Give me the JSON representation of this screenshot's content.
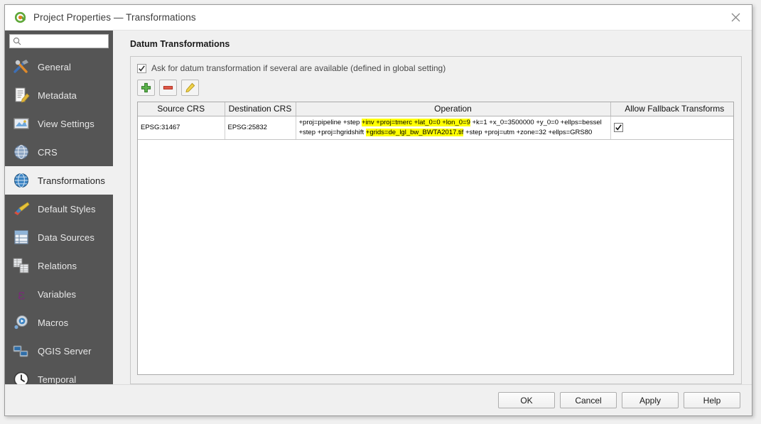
{
  "window": {
    "title": "Project Properties — Transformations",
    "app_icon": "qgis-logo-icon",
    "close_label": "×"
  },
  "sidebar": {
    "search": {
      "value": "",
      "placeholder": ""
    },
    "items": [
      {
        "label": "General",
        "icon": "hammer-wrench-icon"
      },
      {
        "label": "Metadata",
        "icon": "document-pencil-icon"
      },
      {
        "label": "View Settings",
        "icon": "map-view-icon"
      },
      {
        "label": "CRS",
        "icon": "globe-grid-icon"
      },
      {
        "label": "Transformations",
        "icon": "globe-blue-icon"
      },
      {
        "label": "Default Styles",
        "icon": "paintbrush-icon"
      },
      {
        "label": "Data Sources",
        "icon": "table-grid-icon"
      },
      {
        "label": "Relations",
        "icon": "two-tables-icon"
      },
      {
        "label": "Variables",
        "icon": "epsilon-icon"
      },
      {
        "label": "Macros",
        "icon": "gear-play-icon"
      },
      {
        "label": "QGIS Server",
        "icon": "servers-icon"
      },
      {
        "label": "Temporal",
        "icon": "clock-icon"
      }
    ],
    "selected_index": 4
  },
  "main": {
    "group_title": "Datum Transformations",
    "ask_checkbox": {
      "label": "Ask for datum transformation if several are available (defined in global setting)",
      "checked": true
    },
    "toolbar": [
      {
        "name": "add-transformation-button",
        "icon": "green-plus-icon",
        "tooltip": "Add"
      },
      {
        "name": "remove-transformation-button",
        "icon": "red-minus-icon",
        "tooltip": "Remove"
      },
      {
        "name": "edit-transformation-button",
        "icon": "yellow-pencil-icon",
        "tooltip": "Edit"
      }
    ],
    "table": {
      "columns": [
        "Source CRS",
        "Destination CRS",
        "Operation",
        "Allow Fallback Transforms"
      ],
      "rows": [
        {
          "source_crs": "EPSG:31467",
          "destination_crs": "EPSG:25832",
          "operation_line1_pre": "+proj=pipeline +step ",
          "operation_line1_hl": "+inv +proj=tmerc +lat_0=0 +lon_0=9",
          "operation_line1_post": " +k=1 +x_0=3500000 +y_0=0 +ellps=bessel",
          "operation_line2_pre": "+step +proj=hgridshift ",
          "operation_line2_hl": "+grids=de_lgl_bw_BWTA2017.tif",
          "operation_line2_post": " +step +proj=utm +zone=32 +ellps=GRS80",
          "allow_fallback": true
        }
      ]
    }
  },
  "footer": {
    "buttons": [
      {
        "label": "OK",
        "name": "ok-button"
      },
      {
        "label": "Cancel",
        "name": "cancel-button"
      },
      {
        "label": "Apply",
        "name": "apply-button"
      },
      {
        "label": "Help",
        "name": "help-button"
      }
    ]
  },
  "colors": {
    "sidebar_bg": "#555555",
    "panel_bg": "#f0f0f0",
    "highlight": "#ffff00",
    "accent_green": "#4a9e3f",
    "accent_red": "#cc2222",
    "accent_blue": "#3b84c4"
  }
}
